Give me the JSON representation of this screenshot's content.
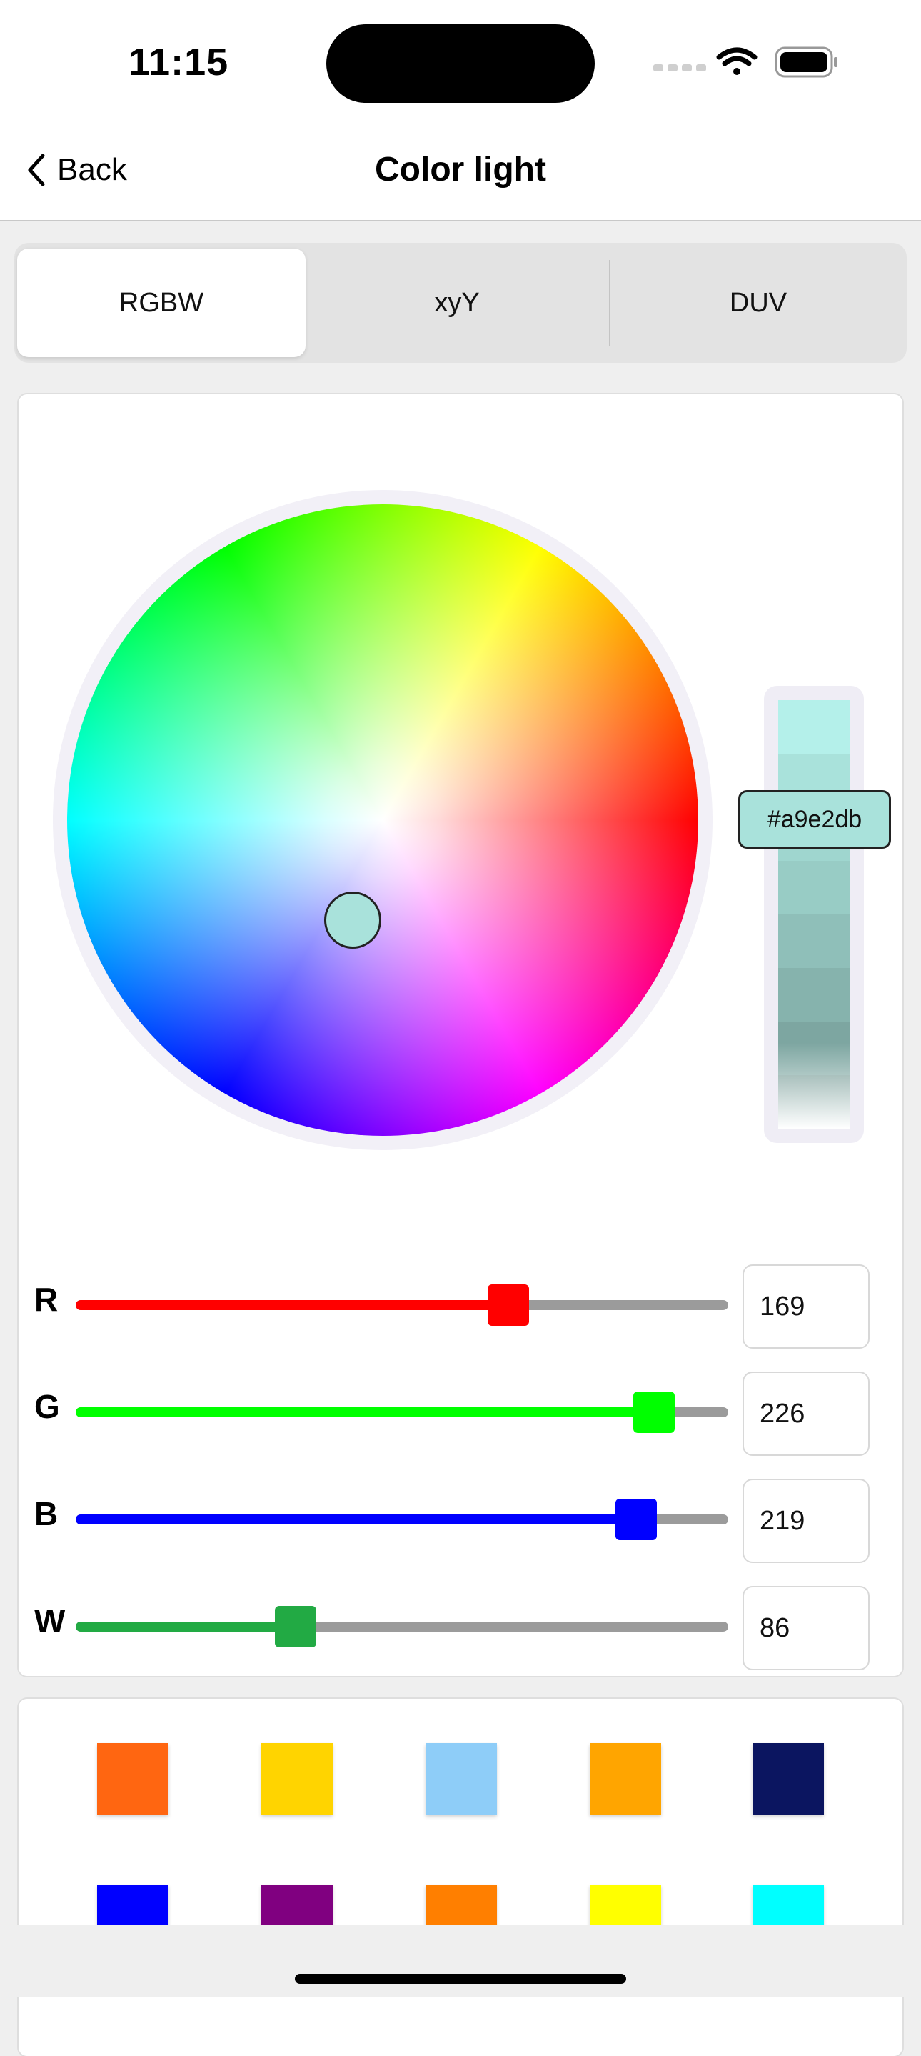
{
  "status": {
    "time": "11:15"
  },
  "nav": {
    "back_label": "Back",
    "title": "Color light"
  },
  "tabs": [
    {
      "label": "RGBW",
      "active": true
    },
    {
      "label": "xyY",
      "active": false
    },
    {
      "label": "DUV",
      "active": false
    }
  ],
  "picker": {
    "hex": "#a9e2db",
    "selected_color": "#a9e2db",
    "brightness_steps": [
      "#b4f0ea",
      "#a9e2db",
      "#9fd6cf",
      "#98ccc5",
      "#8fbfb9",
      "#86b3ad",
      "#7da6a1",
      "#769b96"
    ]
  },
  "sliders": [
    {
      "letter": "R",
      "value": "169",
      "max": 255,
      "color": "#ff0000"
    },
    {
      "letter": "G",
      "value": "226",
      "max": 255,
      "color": "#00ff00"
    },
    {
      "letter": "B",
      "value": "219",
      "max": 255,
      "color": "#0000ff"
    },
    {
      "letter": "W",
      "value": "86",
      "max": 255,
      "color": "#22aa44"
    }
  ],
  "swatches": [
    "#ff6611",
    "#ffd400",
    "#8ecdf8",
    "#ffa500",
    "#0b1560",
    "#0000ff",
    "#800080",
    "#ff7f00",
    "#ffff00",
    "#00ffff"
  ]
}
